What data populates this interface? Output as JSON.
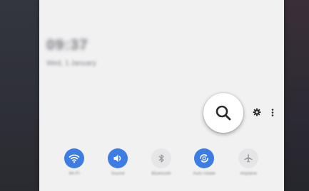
{
  "status": {
    "time": "09:37",
    "date": "Wed, 1 January"
  },
  "panel_controls": {
    "search_icon": "search-icon",
    "settings_icon": "gear-icon",
    "more_icon": "more-vertical-icon"
  },
  "quick_settings": [
    {
      "label": "Wi-Fi",
      "icon": "wifi-icon",
      "state": "on"
    },
    {
      "label": "Sound",
      "icon": "sound-icon",
      "state": "on"
    },
    {
      "label": "Bluetooth",
      "icon": "bluetooth-icon",
      "state": "off"
    },
    {
      "label": "Auto rotate",
      "icon": "auto-rotate-icon",
      "state": "on"
    },
    {
      "label": "Airplane",
      "icon": "airplane-icon",
      "state": "off"
    }
  ],
  "colors": {
    "accent": "#3d7de3",
    "panel": "#f1f1f2"
  }
}
